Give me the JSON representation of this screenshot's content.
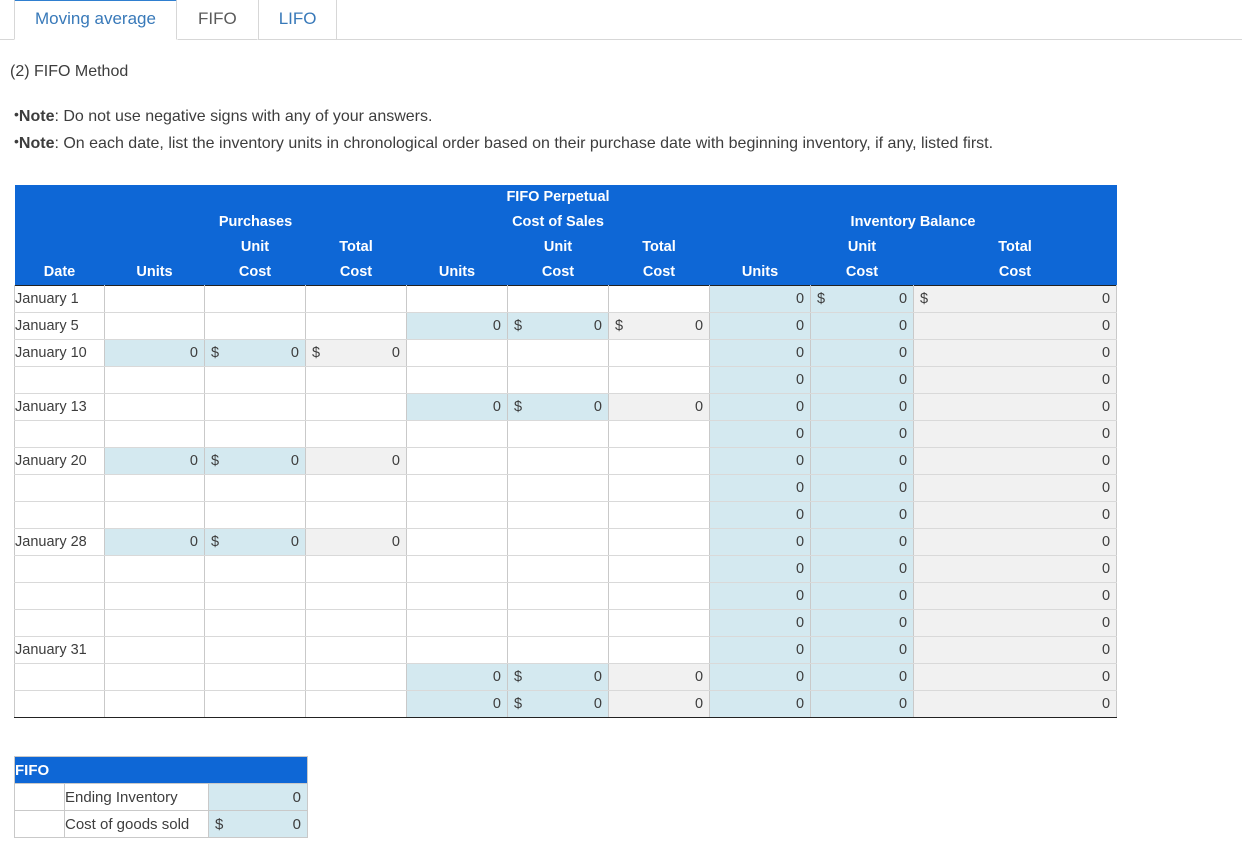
{
  "tabs": [
    {
      "label": "Moving average",
      "state": "active"
    },
    {
      "label": "FIFO",
      "state": "current"
    },
    {
      "label": "LIFO",
      "state": "inactive"
    }
  ],
  "section_title": "(2) FIFO Method",
  "notes": [
    {
      "bullet": "•",
      "label": "Note",
      "text": ": Do not use negative signs with any of your answers."
    },
    {
      "bullet": "•",
      "label": "Note",
      "text": ": On each date, list the inventory units in chronological order based on their purchase date with beginning inventory, if any, listed first."
    }
  ],
  "table": {
    "group_headers": {
      "purchases": "Purchases",
      "fifo_perpetual": "FIFO Perpetual",
      "cost_of_sales": "Cost of Sales",
      "inventory_balance": "Inventory Balance"
    },
    "columns": [
      {
        "key": "date",
        "line1": "",
        "line2": "Date"
      },
      {
        "key": "p_units",
        "line1": "",
        "line2": "Units"
      },
      {
        "key": "p_unit_cost",
        "line1": "Unit",
        "line2": "Cost"
      },
      {
        "key": "p_total_cost",
        "line1": "Total",
        "line2": "Cost"
      },
      {
        "key": "c_units",
        "line1": "",
        "line2": "Units"
      },
      {
        "key": "c_unit_cost",
        "line1": "Unit",
        "line2": "Cost"
      },
      {
        "key": "c_total_cost",
        "line1": "Total",
        "line2": "Cost"
      },
      {
        "key": "i_units",
        "line1": "",
        "line2": "Units"
      },
      {
        "key": "i_unit_cost",
        "line1": "Unit",
        "line2": "Cost"
      },
      {
        "key": "i_total_cost",
        "line1": "Total",
        "line2": "Cost"
      }
    ],
    "currency_symbol": "$",
    "rows": [
      {
        "group": true,
        "date": "January 1",
        "cells": [
          {
            "s": "blank"
          },
          {
            "s": "blank"
          },
          {
            "s": "blank"
          },
          {
            "s": "blank"
          },
          {
            "s": "blank"
          },
          {
            "s": "blank"
          },
          {
            "s": "inp",
            "v": "0"
          },
          {
            "s": "inp",
            "sym": "$",
            "v": "0"
          },
          {
            "s": "calc",
            "sym": "$",
            "v": "0"
          }
        ]
      },
      {
        "group": true,
        "date": "January 5",
        "cells": [
          {
            "s": "blank"
          },
          {
            "s": "blank"
          },
          {
            "s": "blank"
          },
          {
            "s": "inp",
            "v": "0"
          },
          {
            "s": "inp",
            "sym": "$",
            "v": "0"
          },
          {
            "s": "calc",
            "sym": "$",
            "v": "0"
          },
          {
            "s": "inp",
            "v": "0"
          },
          {
            "s": "inp",
            "v": "0"
          },
          {
            "s": "calc",
            "v": "0"
          }
        ]
      },
      {
        "group": true,
        "date": "January 10",
        "cells": [
          {
            "s": "inp",
            "v": "0"
          },
          {
            "s": "inp",
            "sym": "$",
            "v": "0"
          },
          {
            "s": "calc",
            "sym": "$",
            "v": "0"
          },
          {
            "s": "blank"
          },
          {
            "s": "blank"
          },
          {
            "s": "blank"
          },
          {
            "s": "inp",
            "v": "0"
          },
          {
            "s": "inp",
            "v": "0"
          },
          {
            "s": "calc",
            "v": "0"
          }
        ]
      },
      {
        "group": false,
        "date": "",
        "cells": [
          {
            "s": "blank"
          },
          {
            "s": "blank"
          },
          {
            "s": "blank"
          },
          {
            "s": "blank"
          },
          {
            "s": "blank"
          },
          {
            "s": "blank"
          },
          {
            "s": "inp",
            "v": "0"
          },
          {
            "s": "inp",
            "v": "0"
          },
          {
            "s": "calc",
            "v": "0"
          }
        ]
      },
      {
        "group": true,
        "date": "January 13",
        "cells": [
          {
            "s": "blank"
          },
          {
            "s": "blank"
          },
          {
            "s": "blank"
          },
          {
            "s": "inp",
            "v": "0"
          },
          {
            "s": "inp",
            "sym": "$",
            "v": "0"
          },
          {
            "s": "calc",
            "v": "0"
          },
          {
            "s": "inp",
            "v": "0"
          },
          {
            "s": "inp",
            "v": "0"
          },
          {
            "s": "calc",
            "v": "0"
          }
        ]
      },
      {
        "group": false,
        "date": "",
        "cells": [
          {
            "s": "blank"
          },
          {
            "s": "blank"
          },
          {
            "s": "blank"
          },
          {
            "s": "blank"
          },
          {
            "s": "blank"
          },
          {
            "s": "blank"
          },
          {
            "s": "inp",
            "v": "0"
          },
          {
            "s": "inp",
            "v": "0"
          },
          {
            "s": "calc",
            "v": "0"
          }
        ]
      },
      {
        "group": true,
        "date": "January 20",
        "cells": [
          {
            "s": "inp",
            "v": "0"
          },
          {
            "s": "inp",
            "sym": "$",
            "v": "0"
          },
          {
            "s": "calc",
            "v": "0"
          },
          {
            "s": "blank"
          },
          {
            "s": "blank"
          },
          {
            "s": "blank"
          },
          {
            "s": "inp",
            "v": "0"
          },
          {
            "s": "inp",
            "v": "0"
          },
          {
            "s": "calc",
            "v": "0"
          }
        ]
      },
      {
        "group": false,
        "date": "",
        "cells": [
          {
            "s": "blank"
          },
          {
            "s": "blank"
          },
          {
            "s": "blank"
          },
          {
            "s": "blank"
          },
          {
            "s": "blank"
          },
          {
            "s": "blank"
          },
          {
            "s": "inp",
            "v": "0"
          },
          {
            "s": "inp",
            "v": "0"
          },
          {
            "s": "calc",
            "v": "0"
          }
        ]
      },
      {
        "group": false,
        "date": "",
        "cells": [
          {
            "s": "blank"
          },
          {
            "s": "blank"
          },
          {
            "s": "blank"
          },
          {
            "s": "blank"
          },
          {
            "s": "blank"
          },
          {
            "s": "blank"
          },
          {
            "s": "inp",
            "v": "0"
          },
          {
            "s": "inp",
            "v": "0"
          },
          {
            "s": "calc",
            "v": "0"
          }
        ]
      },
      {
        "group": true,
        "date": "January 28",
        "cells": [
          {
            "s": "inp",
            "v": "0"
          },
          {
            "s": "inp",
            "sym": "$",
            "v": "0"
          },
          {
            "s": "calc",
            "v": "0"
          },
          {
            "s": "blank"
          },
          {
            "s": "blank"
          },
          {
            "s": "blank"
          },
          {
            "s": "inp",
            "v": "0"
          },
          {
            "s": "inp",
            "v": "0"
          },
          {
            "s": "calc",
            "v": "0"
          }
        ]
      },
      {
        "group": false,
        "date": "",
        "cells": [
          {
            "s": "blank"
          },
          {
            "s": "blank"
          },
          {
            "s": "blank"
          },
          {
            "s": "blank"
          },
          {
            "s": "blank"
          },
          {
            "s": "blank"
          },
          {
            "s": "inp",
            "v": "0"
          },
          {
            "s": "inp",
            "v": "0"
          },
          {
            "s": "calc",
            "v": "0"
          }
        ]
      },
      {
        "group": false,
        "date": "",
        "cells": [
          {
            "s": "blank"
          },
          {
            "s": "blank"
          },
          {
            "s": "blank"
          },
          {
            "s": "blank"
          },
          {
            "s": "blank"
          },
          {
            "s": "blank"
          },
          {
            "s": "inp",
            "v": "0"
          },
          {
            "s": "inp",
            "v": "0"
          },
          {
            "s": "calc",
            "v": "0"
          }
        ]
      },
      {
        "group": false,
        "date": "",
        "cells": [
          {
            "s": "blank"
          },
          {
            "s": "blank"
          },
          {
            "s": "blank"
          },
          {
            "s": "blank"
          },
          {
            "s": "blank"
          },
          {
            "s": "blank"
          },
          {
            "s": "inp",
            "v": "0"
          },
          {
            "s": "inp",
            "v": "0"
          },
          {
            "s": "calc",
            "v": "0"
          }
        ]
      },
      {
        "group": true,
        "date": "January 31",
        "cells": [
          {
            "s": "blank"
          },
          {
            "s": "blank"
          },
          {
            "s": "blank"
          },
          {
            "s": "blank"
          },
          {
            "s": "blank"
          },
          {
            "s": "blank"
          },
          {
            "s": "inp",
            "v": "0"
          },
          {
            "s": "inp",
            "v": "0"
          },
          {
            "s": "calc",
            "v": "0"
          }
        ]
      },
      {
        "group": false,
        "date": "",
        "cells": [
          {
            "s": "blank"
          },
          {
            "s": "blank"
          },
          {
            "s": "blank"
          },
          {
            "s": "inp",
            "v": "0"
          },
          {
            "s": "inp",
            "sym": "$",
            "v": "0"
          },
          {
            "s": "calc",
            "v": "0"
          },
          {
            "s": "inp",
            "v": "0"
          },
          {
            "s": "inp",
            "v": "0"
          },
          {
            "s": "calc",
            "v": "0"
          }
        ]
      },
      {
        "group": false,
        "last": true,
        "date": "",
        "cells": [
          {
            "s": "blank"
          },
          {
            "s": "blank"
          },
          {
            "s": "blank"
          },
          {
            "s": "inp",
            "v": "0"
          },
          {
            "s": "inp",
            "sym": "$",
            "v": "0"
          },
          {
            "s": "calc",
            "v": "0"
          },
          {
            "s": "inp",
            "v": "0"
          },
          {
            "s": "inp",
            "v": "0"
          },
          {
            "s": "calc",
            "v": "0"
          }
        ]
      }
    ]
  },
  "summary": {
    "title": "FIFO",
    "rows": [
      {
        "label": "Ending Inventory",
        "sym": "",
        "value": "0"
      },
      {
        "label": "Cost of goods sold",
        "sym": "$",
        "value": "0"
      }
    ]
  },
  "colors": {
    "header_blue": "#0e67d6",
    "input_blue": "#d4e9f0",
    "calc_gray": "#f1f1f1",
    "tab_link": "#3879b9",
    "text": "#3d3d3d"
  }
}
